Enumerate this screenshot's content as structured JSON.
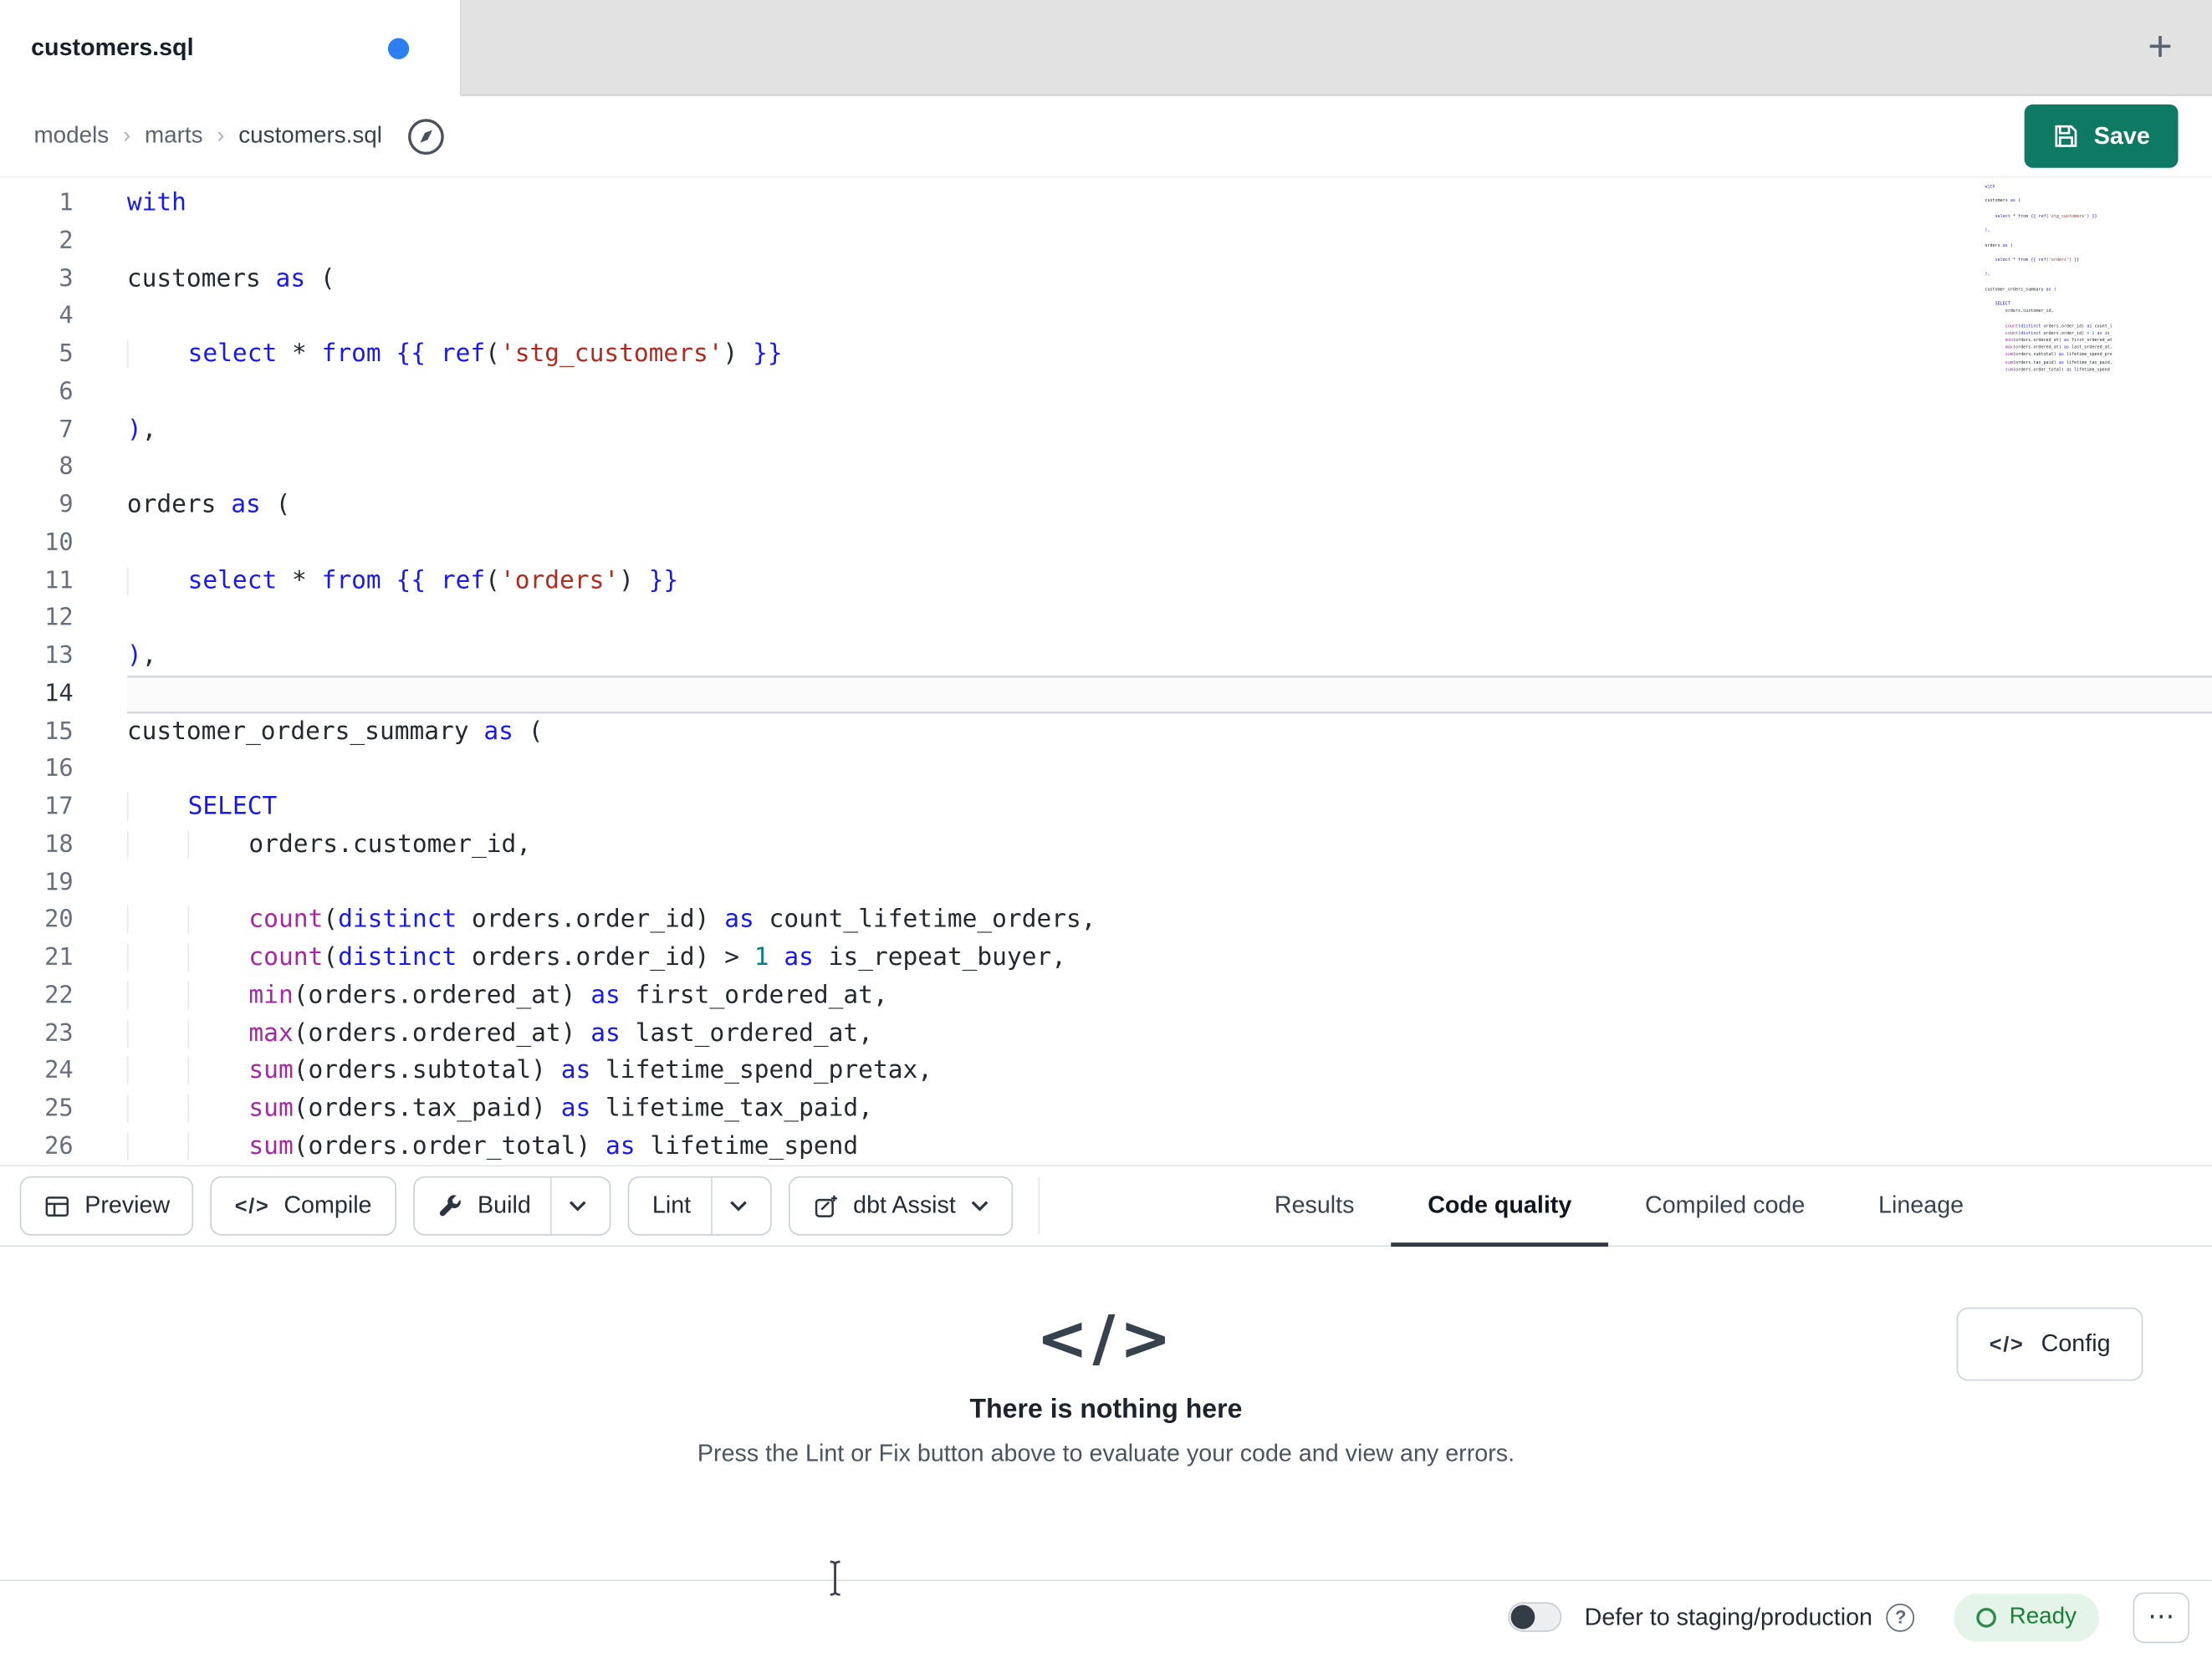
{
  "colors": {
    "accent_green": "#0f7a63",
    "keyword": "#1a1ae8",
    "function": "#a626a4",
    "string": "#b02a20",
    "number": "#0d7d8c",
    "code_text": "#24292f",
    "ready_bg": "#e4f4e8",
    "ready_text": "#1a7f37",
    "tab_dot": "#2d7ff0"
  },
  "icons": {
    "code": "</>"
  },
  "tab_bar": {
    "active_tab": "customers.sql",
    "new_tab": "+"
  },
  "breadcrumb": {
    "items": [
      "models",
      "marts",
      "customers.sql"
    ],
    "separator": "›"
  },
  "header": {
    "save_label": "Save"
  },
  "editor": {
    "current_line": 14,
    "lines": [
      {
        "n": 1,
        "tokens": [
          [
            "with",
            "kw"
          ]
        ]
      },
      {
        "n": 2,
        "tokens": []
      },
      {
        "n": 3,
        "tokens": [
          [
            "customers ",
            "p"
          ],
          [
            "as",
            "kw"
          ],
          [
            " (",
            "p"
          ]
        ]
      },
      {
        "n": 4,
        "tokens": []
      },
      {
        "n": 5,
        "tokens": [
          [
            "    ",
            "p"
          ],
          [
            "select",
            "kw"
          ],
          [
            " * ",
            "p"
          ],
          [
            "from",
            "kw"
          ],
          [
            " ",
            "p"
          ],
          [
            "{{",
            "kw"
          ],
          [
            " ",
            "p"
          ],
          [
            "ref",
            "kw"
          ],
          [
            "(",
            "p"
          ],
          [
            "'stg_customers'",
            "str"
          ],
          [
            ")",
            "p"
          ],
          [
            " ",
            "p"
          ],
          [
            "}}",
            "kw"
          ]
        ]
      },
      {
        "n": 6,
        "tokens": []
      },
      {
        "n": 7,
        "tokens": [
          [
            ")",
            "kw"
          ],
          [
            ",",
            "p"
          ]
        ]
      },
      {
        "n": 8,
        "tokens": []
      },
      {
        "n": 9,
        "tokens": [
          [
            "orders ",
            "p"
          ],
          [
            "as",
            "kw"
          ],
          [
            " (",
            "p"
          ]
        ]
      },
      {
        "n": 10,
        "tokens": []
      },
      {
        "n": 11,
        "tokens": [
          [
            "    ",
            "p"
          ],
          [
            "select",
            "kw"
          ],
          [
            " * ",
            "p"
          ],
          [
            "from",
            "kw"
          ],
          [
            " ",
            "p"
          ],
          [
            "{{",
            "kw"
          ],
          [
            " ",
            "p"
          ],
          [
            "ref",
            "kw"
          ],
          [
            "(",
            "p"
          ],
          [
            "'orders'",
            "str"
          ],
          [
            ")",
            "p"
          ],
          [
            " ",
            "p"
          ],
          [
            "}}",
            "kw"
          ]
        ]
      },
      {
        "n": 12,
        "tokens": []
      },
      {
        "n": 13,
        "tokens": [
          [
            ")",
            "kw"
          ],
          [
            ",",
            "p"
          ]
        ]
      },
      {
        "n": 14,
        "tokens": []
      },
      {
        "n": 15,
        "tokens": [
          [
            "customer_orders_summary ",
            "p"
          ],
          [
            "as",
            "kw"
          ],
          [
            " (",
            "p"
          ]
        ]
      },
      {
        "n": 16,
        "tokens": []
      },
      {
        "n": 17,
        "tokens": [
          [
            "    ",
            "p"
          ],
          [
            "SELECT",
            "kw"
          ]
        ]
      },
      {
        "n": 18,
        "tokens": [
          [
            "        ",
            "p"
          ],
          [
            "orders.customer_id,",
            "p"
          ]
        ]
      },
      {
        "n": 19,
        "tokens": []
      },
      {
        "n": 20,
        "tokens": [
          [
            "        ",
            "p"
          ],
          [
            "count",
            "fn"
          ],
          [
            "(",
            "p"
          ],
          [
            "distinct",
            "kw"
          ],
          [
            " orders.order_id",
            "p"
          ],
          [
            ")",
            "p"
          ],
          [
            " ",
            "p"
          ],
          [
            "as",
            "kw"
          ],
          [
            " count_lifetime_orders,",
            "p"
          ]
        ]
      },
      {
        "n": 21,
        "tokens": [
          [
            "        ",
            "p"
          ],
          [
            "count",
            "fn"
          ],
          [
            "(",
            "p"
          ],
          [
            "distinct",
            "kw"
          ],
          [
            " orders.order_id",
            "p"
          ],
          [
            ")",
            "p"
          ],
          [
            " > ",
            "p"
          ],
          [
            "1",
            "num"
          ],
          [
            " ",
            "p"
          ],
          [
            "as",
            "kw"
          ],
          [
            " is_repeat_buyer,",
            "p"
          ]
        ]
      },
      {
        "n": 22,
        "tokens": [
          [
            "        ",
            "p"
          ],
          [
            "min",
            "fn"
          ],
          [
            "(",
            "p"
          ],
          [
            "orders.ordered_at",
            "p"
          ],
          [
            ")",
            "p"
          ],
          [
            " ",
            "p"
          ],
          [
            "as",
            "kw"
          ],
          [
            " first_ordered_at,",
            "p"
          ]
        ]
      },
      {
        "n": 23,
        "tokens": [
          [
            "        ",
            "p"
          ],
          [
            "max",
            "fn"
          ],
          [
            "(",
            "p"
          ],
          [
            "orders.ordered_at",
            "p"
          ],
          [
            ")",
            "p"
          ],
          [
            " ",
            "p"
          ],
          [
            "as",
            "kw"
          ],
          [
            " last_ordered_at,",
            "p"
          ]
        ]
      },
      {
        "n": 24,
        "tokens": [
          [
            "        ",
            "p"
          ],
          [
            "sum",
            "fn"
          ],
          [
            "(",
            "p"
          ],
          [
            "orders.subtotal",
            "p"
          ],
          [
            ")",
            "p"
          ],
          [
            " ",
            "p"
          ],
          [
            "as",
            "kw"
          ],
          [
            " lifetime_spend_pretax,",
            "p"
          ]
        ]
      },
      {
        "n": 25,
        "tokens": [
          [
            "        ",
            "p"
          ],
          [
            "sum",
            "fn"
          ],
          [
            "(",
            "p"
          ],
          [
            "orders.tax_paid",
            "p"
          ],
          [
            ")",
            "p"
          ],
          [
            " ",
            "p"
          ],
          [
            "as",
            "kw"
          ],
          [
            " lifetime_tax_paid,",
            "p"
          ]
        ]
      },
      {
        "n": 26,
        "tokens": [
          [
            "        ",
            "p"
          ],
          [
            "sum",
            "fn"
          ],
          [
            "(",
            "p"
          ],
          [
            "orders.order_total",
            "p"
          ],
          [
            ")",
            "p"
          ],
          [
            " ",
            "p"
          ],
          [
            "as",
            "kw"
          ],
          [
            " lifetime_spend",
            "p"
          ]
        ]
      }
    ]
  },
  "toolbar": {
    "preview_label": "Preview",
    "compile_label": "Compile",
    "build_label": "Build",
    "lint_label": "Lint",
    "assist_label": "dbt Assist",
    "tabs": [
      {
        "label": "Results",
        "active": false
      },
      {
        "label": "Code quality",
        "active": true
      },
      {
        "label": "Compiled code",
        "active": false
      },
      {
        "label": "Lineage",
        "active": false
      }
    ]
  },
  "empty_state": {
    "icon": "</>",
    "title": "There is nothing here",
    "subtitle": "Press the Lint or Fix button above to evaluate your code and view any errors.",
    "config_label": "Config"
  },
  "status_bar": {
    "defer_label": "Defer to staging/production",
    "help_icon": "?",
    "ready_label": "Ready",
    "more_icon": "⋯"
  }
}
